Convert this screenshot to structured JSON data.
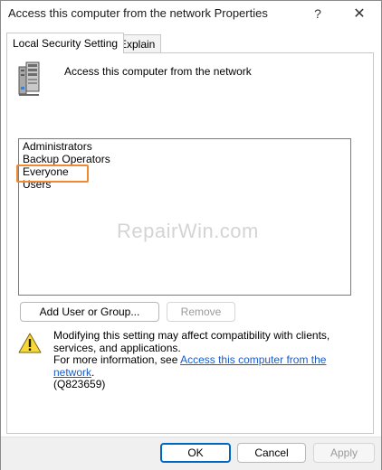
{
  "window": {
    "title": "Access this computer from the network Properties",
    "help_glyph": "?",
    "close_glyph": "✕"
  },
  "tabs": [
    {
      "label": "Local Security Setting",
      "active": true
    },
    {
      "label": "Explain",
      "active": false
    }
  ],
  "policy": {
    "icon": "server-icon",
    "name": "Access this computer from the network"
  },
  "accounts": [
    "Administrators",
    "Backup Operators",
    "Everyone",
    "Users"
  ],
  "highlighted_account": "Everyone",
  "watermark": "RepairWin.com",
  "buttons": {
    "add": "Add User or Group...",
    "remove": "Remove",
    "ok": "OK",
    "cancel": "Cancel",
    "apply": "Apply"
  },
  "warning": {
    "icon": "warning-icon",
    "line1": "Modifying this setting may affect compatibility with clients, services, and applications.",
    "more_prefix": "For more information, see ",
    "link_text": "Access this computer from the network",
    "more_suffix": ".",
    "kb": "(Q823659)"
  },
  "colors": {
    "highlight": "#f08a30",
    "link": "#1a5cc8",
    "default_button_border": "#0067c0"
  }
}
